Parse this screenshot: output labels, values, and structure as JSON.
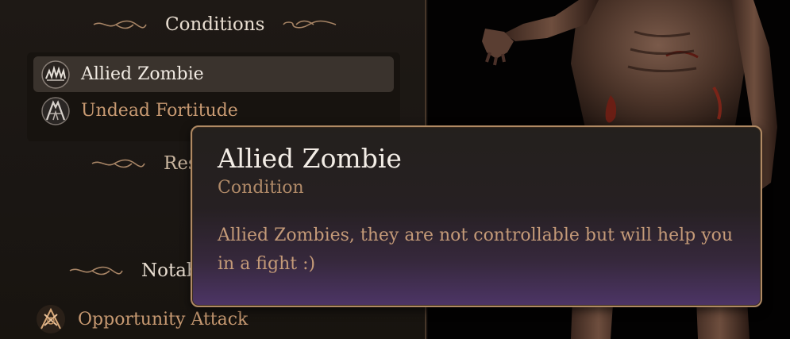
{
  "panel": {
    "conditions_header": "Conditions",
    "resistances_header_partial": "Res",
    "notable_header_partial": "Notab",
    "conditions": [
      {
        "label": "Allied Zombie",
        "icon": "allied-zombie-icon",
        "selected": true
      },
      {
        "label": "Undead Fortitude",
        "icon": "undead-fortitude-icon",
        "selected": false
      }
    ],
    "notable": [
      {
        "label": "Opportunity Attack",
        "icon": "opportunity-attack-icon"
      }
    ]
  },
  "tooltip": {
    "title": "Allied Zombie",
    "subtitle": "Condition",
    "description": "Allied Zombies, they are not controllable but will help you in a fight :)"
  },
  "colors": {
    "accent_gold": "#b08a64",
    "label_copper": "#c89a72",
    "tooltip_purple": "#4d3566"
  }
}
